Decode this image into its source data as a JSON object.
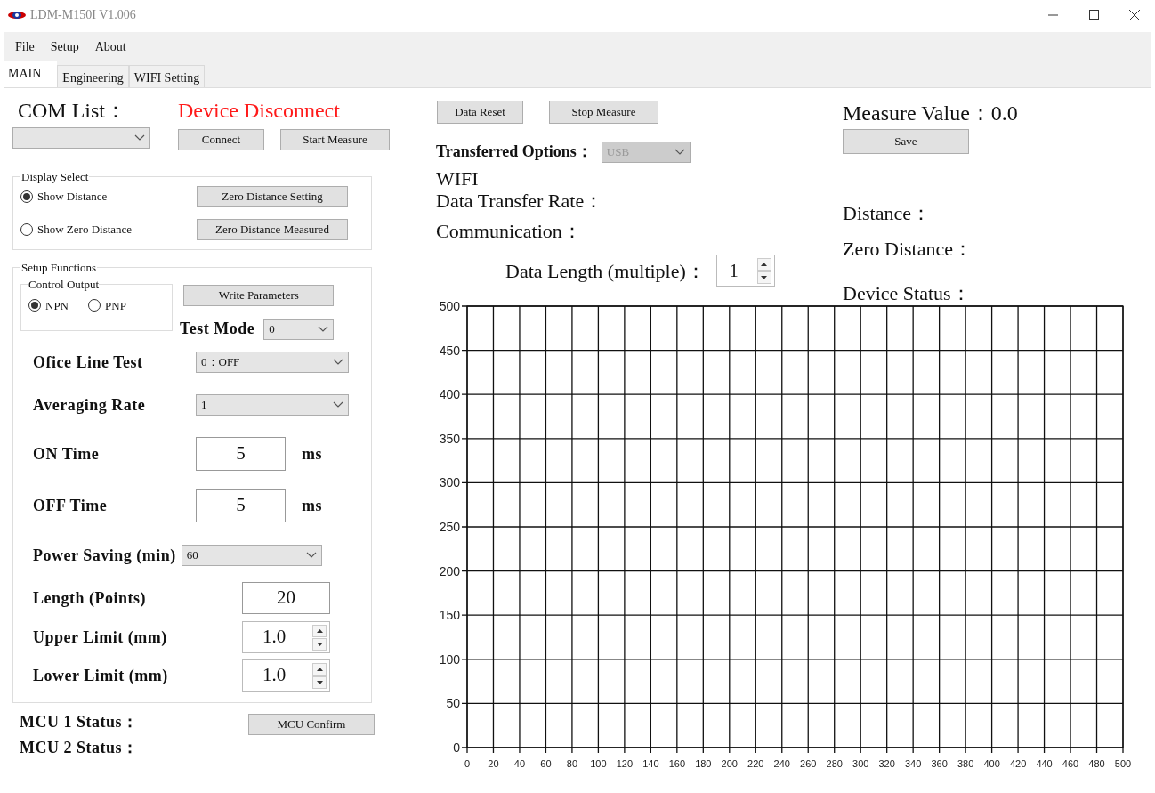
{
  "window": {
    "title": "LDM-M150I V1.006"
  },
  "menu": [
    "File",
    "Setup",
    "About"
  ],
  "tabs": [
    {
      "label": "MAIN",
      "selected": true
    },
    {
      "label": "Engineering",
      "selected": false
    },
    {
      "label": "WIFI Setting",
      "selected": false
    }
  ],
  "com_list": {
    "label": "COM List："
  },
  "connection_status": "Device Disconnect",
  "top_buttons": [
    "Connect",
    "Start Measure"
  ],
  "display_select": {
    "title": "Display Select",
    "options": [
      {
        "label": "Show Distance",
        "selected": true
      },
      {
        "label": "Show Zero Distance",
        "selected": false
      }
    ],
    "buttons": [
      "Zero Distance Setting",
      "Zero Distance Measured"
    ]
  },
  "setup_functions": {
    "title": "Setup Functions",
    "control_output": {
      "title": "Control Output",
      "options": [
        {
          "label": "NPN",
          "selected": true
        },
        {
          "label": "PNP",
          "selected": false
        }
      ]
    },
    "write_button": "Write Parameters",
    "test_mode": {
      "label": "Test Mode",
      "value": "0"
    },
    "rows": [
      {
        "kind": "select",
        "label": "Ofice Line Test",
        "value": "0：OFF"
      },
      {
        "kind": "select",
        "label": "Averaging Rate",
        "value": "1"
      },
      {
        "kind": "input",
        "label": "ON Time",
        "value": "5",
        "unit": "ms"
      },
      {
        "kind": "input",
        "label": "OFF Time",
        "value": "5",
        "unit": "ms"
      },
      {
        "kind": "select",
        "label": "Power Saving (min)",
        "value": "60"
      },
      {
        "kind": "input",
        "label": "Length (Points)",
        "value": "20"
      },
      {
        "kind": "spin",
        "label": "Upper Limit (mm)",
        "value": "1.0"
      },
      {
        "kind": "spin",
        "label": "Lower Limit (mm)",
        "value": "1.0"
      }
    ]
  },
  "mcu": {
    "labels": [
      "MCU 1 Status：",
      "MCU 2 Status："
    ],
    "button": "MCU Confirm"
  },
  "right_buttons": [
    "Data Reset",
    "Stop Measure"
  ],
  "measure_value": "Measure Value：0.0",
  "save_button": "Save",
  "transferred_options": {
    "label": "Transferred Options：",
    "value": "USB",
    "disabled": true
  },
  "wifi_labels": [
    "WIFI",
    "Data Transfer Rate：",
    "Communication："
  ],
  "status_labels": [
    "Distance：",
    "Zero Distance：",
    "Device Status："
  ],
  "data_length": {
    "label": "Data Length (multiple)：",
    "value": "1"
  },
  "chart": {
    "chart_data": {
      "type": "line",
      "grid": true,
      "xlim": [
        0,
        500
      ],
      "ylim": [
        0,
        500
      ],
      "xticks": [
        0,
        20,
        40,
        60,
        80,
        100,
        120,
        140,
        160,
        180,
        200,
        220,
        240,
        260,
        280,
        300,
        320,
        340,
        360,
        380,
        400,
        420,
        440,
        460,
        480,
        500
      ],
      "yticks": [
        0,
        50,
        100,
        150,
        200,
        250,
        300,
        350,
        400,
        450,
        500
      ]
    }
  }
}
